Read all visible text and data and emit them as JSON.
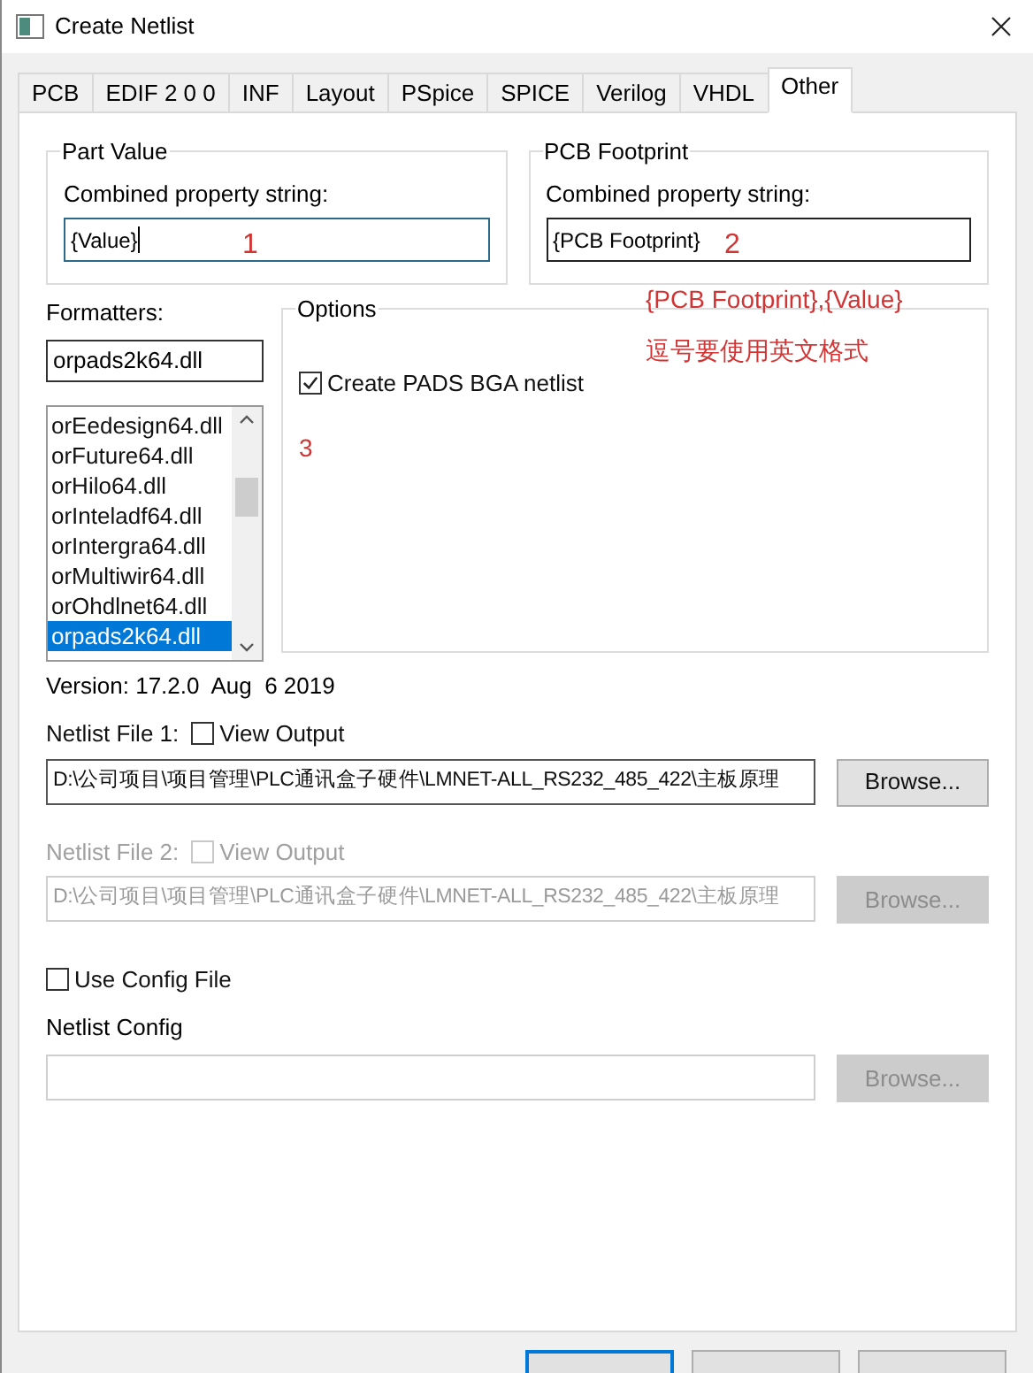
{
  "window": {
    "title": "Create Netlist"
  },
  "tabs": [
    {
      "label": "PCB",
      "selected": false
    },
    {
      "label": "EDIF 2 0 0",
      "selected": false
    },
    {
      "label": "INF",
      "selected": false
    },
    {
      "label": "Layout",
      "selected": false
    },
    {
      "label": "PSpice",
      "selected": false
    },
    {
      "label": "SPICE",
      "selected": false
    },
    {
      "label": "Verilog",
      "selected": false
    },
    {
      "label": "VHDL",
      "selected": false
    },
    {
      "label": "Other",
      "selected": true
    }
  ],
  "property_groups": [
    {
      "title": "Part Value",
      "label": "Combined property string:",
      "value": "{Value}",
      "focused": true,
      "annotation": "1"
    },
    {
      "title": "PCB Footprint",
      "label": "Combined property string:",
      "value": "{PCB Footprint}",
      "focused": false,
      "annotation": "2"
    }
  ],
  "annotation_notes": [
    "{PCB Footprint},{Value}",
    "逗号要使用英文格式"
  ],
  "formatters": {
    "label": "Formatters:",
    "value": "orpads2k64.dll",
    "items": [
      {
        "label": "orEedesign64.dll",
        "selected": false
      },
      {
        "label": "orFuture64.dll",
        "selected": false
      },
      {
        "label": "orHilo64.dll",
        "selected": false
      },
      {
        "label": "orInteladf64.dll",
        "selected": false
      },
      {
        "label": "orIntergra64.dll",
        "selected": false
      },
      {
        "label": "orMultiwir64.dll",
        "selected": false
      },
      {
        "label": "orOhdlnet64.dll",
        "selected": false
      },
      {
        "label": "orpads2k64.dll",
        "selected": true
      }
    ]
  },
  "options": {
    "title": "Options",
    "checkboxes": [
      {
        "label": "Create PADS BGA netlist",
        "checked": true
      }
    ],
    "annotation": "3"
  },
  "version": "Version: 17.2.0  Aug  6 2019",
  "netlist_files": [
    {
      "label": "Netlist File 1:",
      "view_output": {
        "label": "View Output",
        "checked": false
      },
      "path": "D:\\公司项目\\项目管理\\PLC通讯盒子硬件\\LMNET-ALL_RS232_485_422\\主板原理",
      "browse": "Browse...",
      "disabled": false
    },
    {
      "label": "Netlist File 2:",
      "view_output": {
        "label": "View Output",
        "checked": false
      },
      "path": "D:\\公司项目\\项目管理\\PLC通讯盒子硬件\\LMNET-ALL_RS232_485_422\\主板原理",
      "browse": "Browse...",
      "disabled": true
    }
  ],
  "use_config": {
    "label": "Use Config File",
    "checked": false
  },
  "netlist_config": {
    "label": "Netlist Config",
    "browse": "Browse...",
    "disabled": true
  },
  "buttons": [
    {
      "default": true
    },
    {
      "default": false
    },
    {
      "default": false
    }
  ]
}
